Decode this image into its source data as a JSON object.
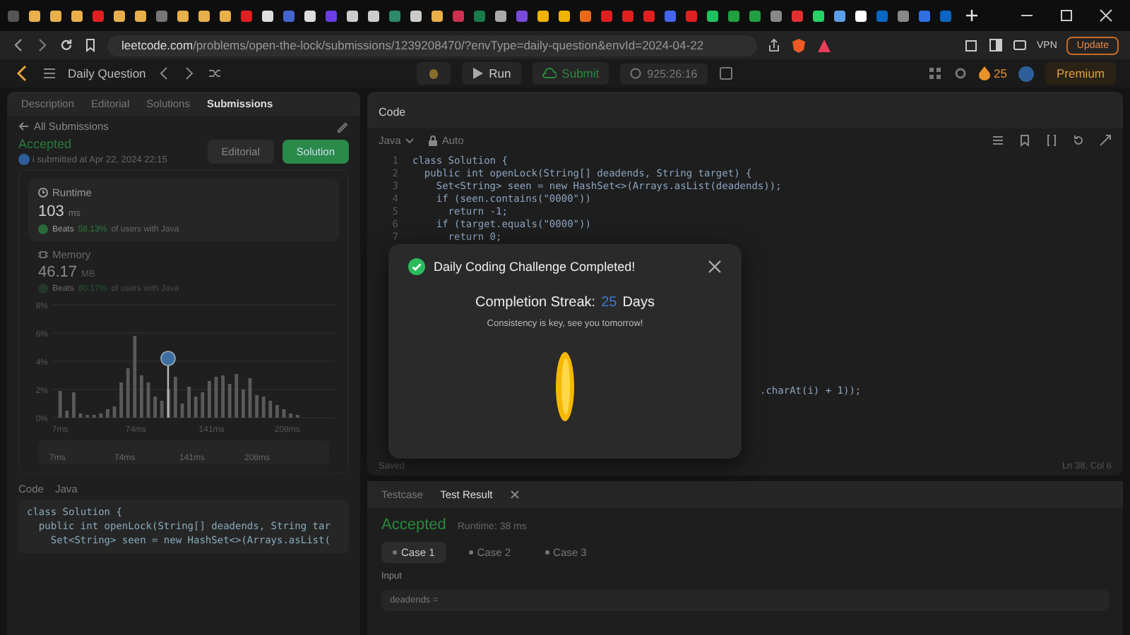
{
  "browser": {
    "url_host": "leetcode.com",
    "url_path": "/problems/open-the-lock/submissions/1239208470/?envType=daily-question&envId=2024-04-22",
    "vpn": "VPN",
    "update": "Update"
  },
  "header": {
    "title": "Daily Question",
    "run": "Run",
    "submit": "Submit",
    "timer": "925:26:16",
    "streak": "25",
    "premium": "Premium"
  },
  "left_tabs": [
    {
      "label": "Description",
      "selected": false
    },
    {
      "label": "Editorial",
      "selected": false
    },
    {
      "label": "Solutions",
      "selected": false
    },
    {
      "label": "Submissions",
      "selected": true
    }
  ],
  "back_link": "All Submissions",
  "submission": {
    "status": "Accepted",
    "submitted": "i submitted at Apr 22, 2024 22:15",
    "buttons": [
      {
        "label": "Editorial",
        "kind": "secondary"
      },
      {
        "label": "Solution",
        "kind": "primary"
      }
    ]
  },
  "runtime": {
    "title": "Runtime",
    "value": "103",
    "unit": "ms",
    "beats_label": "Beats",
    "beats_value": "58.13%",
    "beats_suffix": "of users with Java"
  },
  "memory": {
    "title": "Memory",
    "value": "46.17",
    "unit": "MB",
    "beats_label": "Beats",
    "beats_value": "80.17%",
    "beats_suffix": "of users with Java",
    "chart_data": {
      "type": "bar",
      "x": [
        7,
        13,
        19,
        25,
        31,
        37,
        43,
        49,
        55,
        61,
        67,
        73,
        79,
        85,
        91,
        97,
        103,
        109,
        115,
        121,
        127,
        133,
        139,
        145,
        151,
        157,
        163,
        169,
        175,
        181,
        187,
        193,
        199,
        205,
        211,
        217
      ],
      "series": [
        {
          "color": "#5a5a5a",
          "values": [
            1.9,
            0.5,
            1.8,
            0.3,
            0.2,
            0.2,
            0.3,
            0.6,
            0.8,
            2.5,
            3.5,
            5.8,
            3.0,
            2.5,
            1.5,
            1.2,
            2.0,
            2.9,
            1.0,
            2.2,
            1.5,
            1.8,
            2.6,
            2.9,
            3.0,
            2.4,
            3.1,
            2.0,
            2.8,
            1.6,
            1.5,
            1.2,
            0.9,
            0.6,
            0.3,
            0.2
          ]
        }
      ],
      "xlim": [
        0,
        250
      ],
      "ylim": [
        0,
        8
      ],
      "xticks": [
        {
          "value": 7,
          "label": "7ms"
        },
        {
          "value": 74,
          "label": "74ms"
        },
        {
          "value": 141,
          "label": "141ms"
        },
        {
          "value": 208,
          "label": "208ms"
        }
      ],
      "yticks": [
        {
          "value": 0,
          "label": "0%"
        },
        {
          "value": 2,
          "label": "2%"
        },
        {
          "value": 4,
          "label": "4%"
        },
        {
          "value": 6,
          "label": "6%"
        },
        {
          "value": 8,
          "label": "8%"
        }
      ],
      "grid": true
    },
    "overview_labels": [
      "7ms",
      "74ms",
      "141ms",
      "208ms"
    ]
  },
  "code_preview": {
    "title": "Code",
    "language": "Java",
    "lines": [
      "class Solution {",
      "  public int openLock(String[] deadends, String tar",
      "    Set<String> seen = new HashSet<>(Arrays.asList("
    ]
  },
  "editor": {
    "title": "Code",
    "language": "Java",
    "mode": "Auto",
    "lines": [
      {
        "number": "1",
        "text": "class Solution {"
      },
      {
        "number": "2",
        "text": "  public int openLock(String[] deadends, String target) {"
      },
      {
        "number": "3",
        "text": "    Set<String> seen = new HashSet<>(Arrays.asList(deadends));"
      },
      {
        "number": "4",
        "text": "    if (seen.contains(\"0000\"))"
      },
      {
        "number": "5",
        "text": "      return -1;"
      },
      {
        "number": "6",
        "text": "    if (target.equals(\"0000\"))"
      },
      {
        "number": "7",
        "text": "      return 0;"
      }
    ],
    "fragment": ".charAt(i) + 1));",
    "status": "Saved",
    "position": "Ln 38, Col 6"
  },
  "results": {
    "tabs": [
      {
        "label": "Testcase",
        "selected": false
      },
      {
        "label": "Test Result",
        "selected": true
      }
    ],
    "status": "Accepted",
    "runtime": "Runtime: 38 ms",
    "cases": [
      {
        "label": "Case 1",
        "selected": true
      },
      {
        "label": "Case 2",
        "selected": false
      },
      {
        "label": "Case 3",
        "selected": false
      }
    ],
    "input_label": "Input",
    "param": "deadends ="
  },
  "modal": {
    "title": "Daily Coding Challenge Completed!",
    "streak_label": "Completion Streak:",
    "streak_value": "25",
    "streak_unit": "Days",
    "message": "Consistency is key, see you tomorrow!"
  }
}
